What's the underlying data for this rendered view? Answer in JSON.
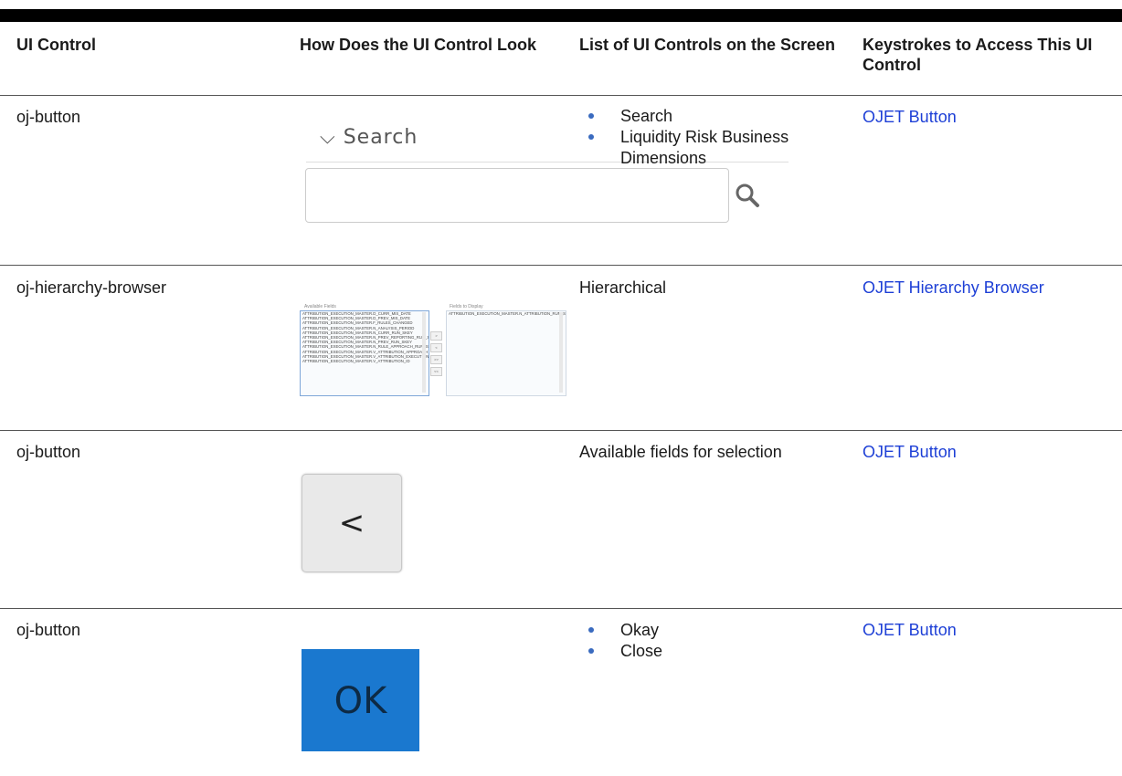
{
  "headers": {
    "col1": "UI Control",
    "col2": "How Does the UI Control Look",
    "col3": "List of UI Controls on the Screen",
    "col4": "Keystrokes to Access This UI Control"
  },
  "rows": [
    {
      "control": "oj-button",
      "list": [
        "Search",
        "Liquidity Risk Business Dimensions"
      ],
      "link": "OJET Button",
      "preview": {
        "search_label": "Search",
        "chevron_icon": "chevron-down-icon",
        "search_icon": "magnifier-icon"
      }
    },
    {
      "control": "oj-hierarchy-browser",
      "list_text": "Hierarchical",
      "link": "OJET Hierarchy Browser",
      "preview": {
        "available_label": "Available Fields",
        "display_label": "Fields to Display",
        "available_items": [
          "ATTRIBUTION_EXECUTION_MASTER.D_CURR_MIS_DATE",
          "ATTRIBUTION_EXECUTION_MASTER.D_PREV_MIS_DATE",
          "ATTRIBUTION_EXECUTION_MASTER.F_RULES_CHANGED",
          "ATTRIBUTION_EXECUTION_MASTER.N_ANALYSIS_PERIOD",
          "ATTRIBUTION_EXECUTION_MASTER.N_CURR_RUN_SKEY",
          "ATTRIBUTION_EXECUTION_MASTER.N_PREV_REPORTING_RUN_SKEY",
          "ATTRIBUTION_EXECUTION_MASTER.N_PREV_RUN_SKEY",
          "ATTRIBUTION_EXECUTION_MASTER.N_RULE_APPROACH_RUN_SKEY",
          "ATTRIBUTION_EXECUTION_MASTER.V_ATTRIBUTION_APPROACH",
          "ATTRIBUTION_EXECUTION_MASTER.V_ATTRIBUTION_EXECUTION_DESC",
          "ATTRIBUTION_EXECUTION_MASTER.V_ATTRIBUTION_ID"
        ],
        "display_items": [
          "ATTRIBUTION_EXECUTION_MASTER.N_ATTRIBUTION_RUN_SKEY"
        ],
        "buttons": [
          ">",
          "<",
          ">>",
          "<<"
        ]
      }
    },
    {
      "control": "oj-button",
      "list_text": "Available fields for selection",
      "link": "OJET Button",
      "preview": {
        "button_label": "<"
      }
    },
    {
      "control": "oj-button",
      "list": [
        "Okay",
        "Close"
      ],
      "link": "OJET Button",
      "preview": {
        "button_label": "OK",
        "button_color": "#1a78cf"
      }
    }
  ]
}
